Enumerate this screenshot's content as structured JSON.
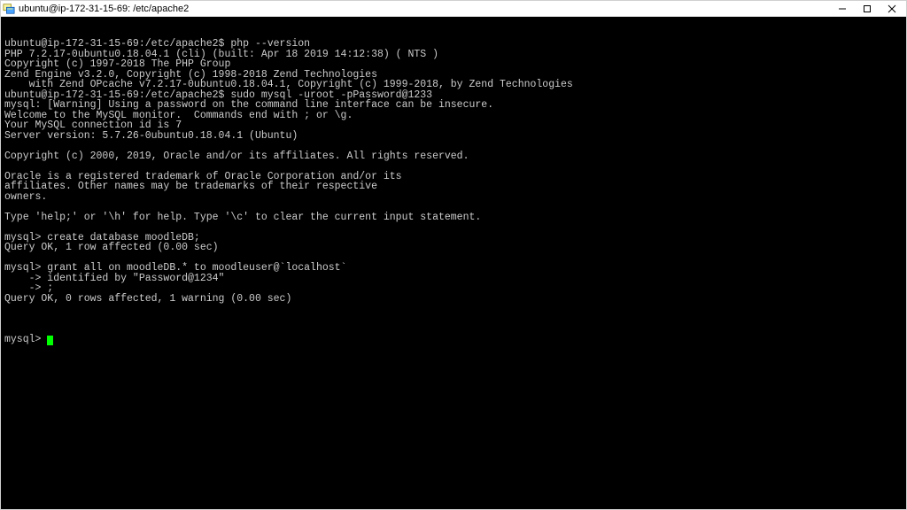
{
  "window": {
    "title": "ubuntu@ip-172-31-15-69: /etc/apache2"
  },
  "terminal": {
    "lines": [
      "ubuntu@ip-172-31-15-69:/etc/apache2$ php --version",
      "PHP 7.2.17-0ubuntu0.18.04.1 (cli) (built: Apr 18 2019 14:12:38) ( NTS )",
      "Copyright (c) 1997-2018 The PHP Group",
      "Zend Engine v3.2.0, Copyright (c) 1998-2018 Zend Technologies",
      "    with Zend OPcache v7.2.17-0ubuntu0.18.04.1, Copyright (c) 1999-2018, by Zend Technologies",
      "ubuntu@ip-172-31-15-69:/etc/apache2$ sudo mysql -uroot -pPassword@1233",
      "mysql: [Warning] Using a password on the command line interface can be insecure.",
      "Welcome to the MySQL monitor.  Commands end with ; or \\g.",
      "Your MySQL connection id is 7",
      "Server version: 5.7.26-0ubuntu0.18.04.1 (Ubuntu)",
      "",
      "Copyright (c) 2000, 2019, Oracle and/or its affiliates. All rights reserved.",
      "",
      "Oracle is a registered trademark of Oracle Corporation and/or its",
      "affiliates. Other names may be trademarks of their respective",
      "owners.",
      "",
      "Type 'help;' or '\\h' for help. Type '\\c' to clear the current input statement.",
      "",
      "mysql> create database moodleDB;",
      "Query OK, 1 row affected (0.00 sec)",
      "",
      "mysql> grant all on moodleDB.* to moodleuser@`localhost`",
      "    -> identified by \"Password@1234\"",
      "    -> ;",
      "Query OK, 0 rows affected, 1 warning (0.00 sec)",
      ""
    ],
    "prompt": "mysql> "
  }
}
